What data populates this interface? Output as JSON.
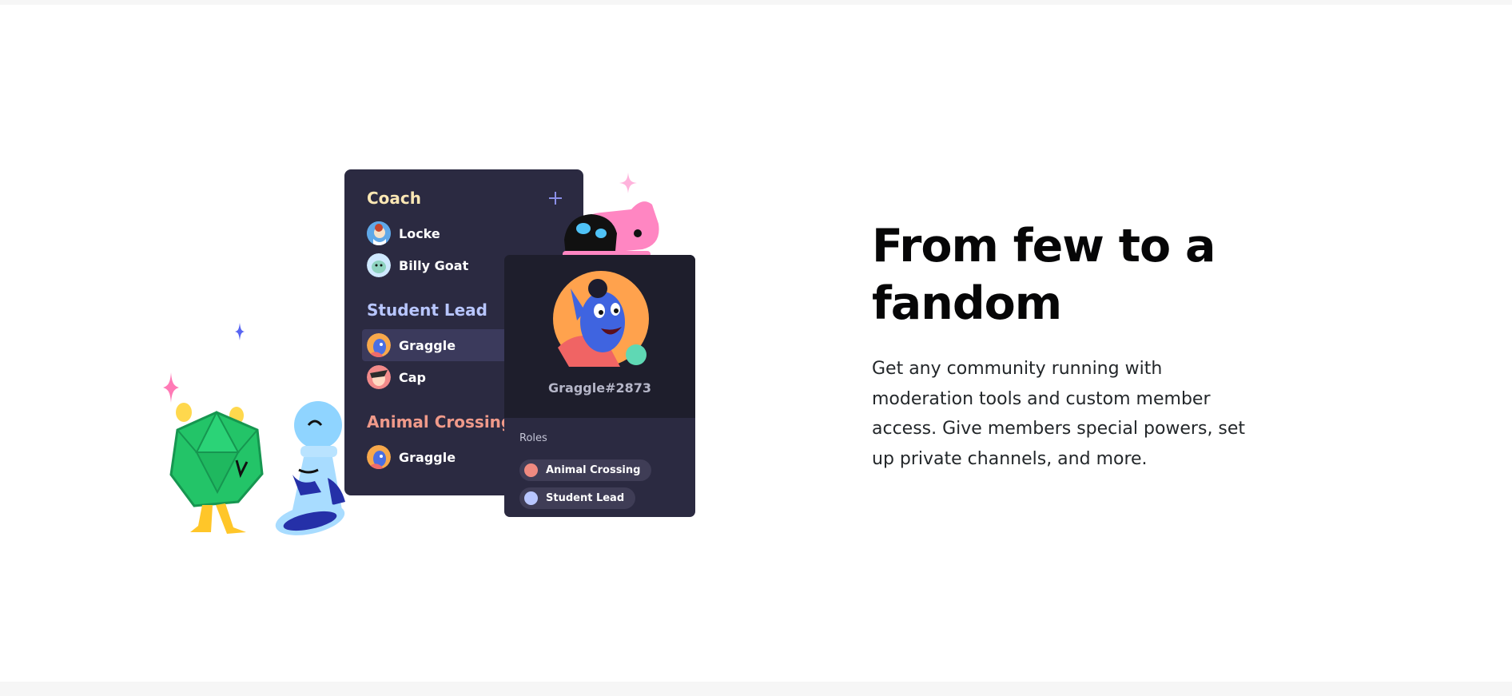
{
  "headline": "From few to a fandom",
  "body": "Get any community running with moderation tools and custom member access. Give members special powers, set up private channels, and more.",
  "member_list": {
    "groups": [
      {
        "title": "Coach",
        "color": "#fbe7b4",
        "members": [
          {
            "name": "Locke",
            "avatar": "locke-avatar"
          },
          {
            "name": "Billy Goat",
            "avatar": "billy-goat-avatar"
          }
        ]
      },
      {
        "title": "Student Lead",
        "color": "#b8c6ff",
        "members": [
          {
            "name": "Graggle",
            "avatar": "graggle-avatar",
            "highlighted": true
          },
          {
            "name": "Cap",
            "avatar": "cap-avatar"
          }
        ]
      },
      {
        "title": "Animal Crossing",
        "color": "#f09a8a",
        "members": [
          {
            "name": "Graggle",
            "avatar": "graggle-avatar"
          }
        ]
      }
    ],
    "add_icon": "plus-icon"
  },
  "profile": {
    "tag": "Graggle#2873",
    "roles_label": "Roles",
    "roles": [
      {
        "name": "Animal Crossing",
        "color": "#ef8a80"
      },
      {
        "name": "Student Lead",
        "color": "#b8c6ff"
      }
    ]
  },
  "colors": {
    "panel": "#2b2a41",
    "card_top": "#1e1e2c",
    "status_online": "#5fd8b4",
    "sparkle_pink": "#ff8fd0",
    "sparkle_blue": "#5865f2"
  }
}
